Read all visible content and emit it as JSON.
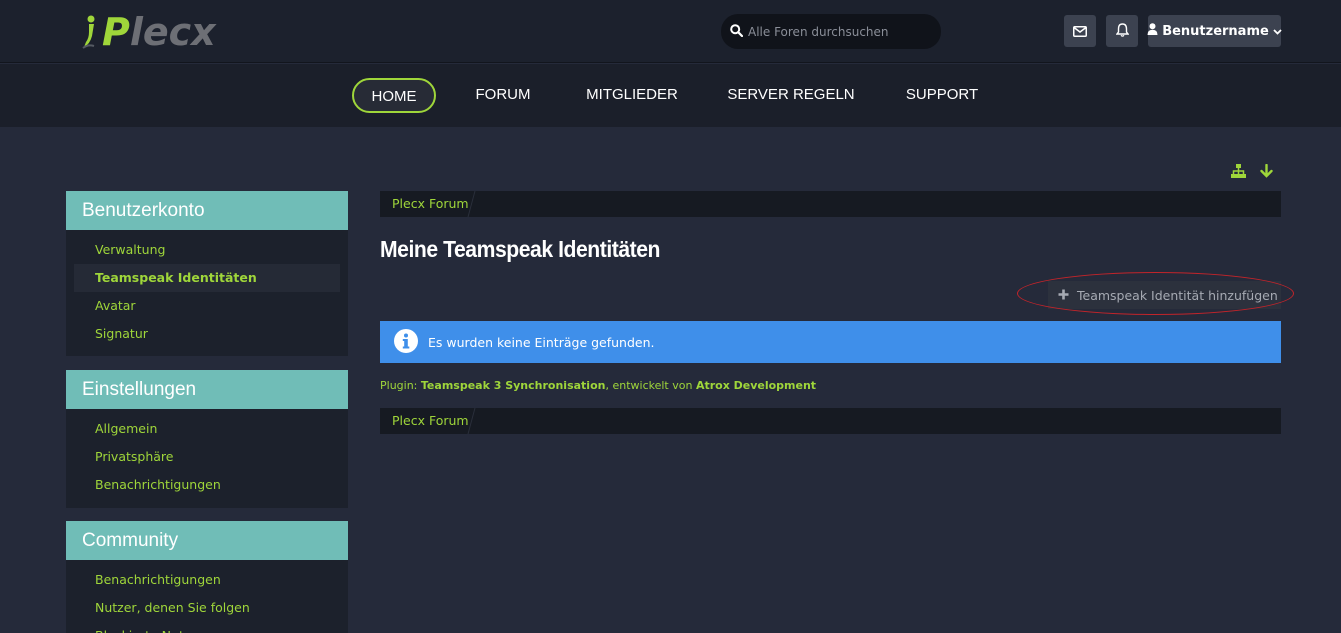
{
  "header": {
    "logo_text_first": "P",
    "logo_text_rest": "lecx",
    "search_placeholder": "Alle Foren durchsuchen",
    "username": "Benutzername"
  },
  "nav": {
    "items": [
      "HOME",
      "FORUM",
      "MITGLIEDER",
      "SERVER REGELN",
      "SUPPORT"
    ]
  },
  "sidebar": {
    "sections": [
      {
        "title": "Benutzerkonto",
        "items": [
          "Verwaltung",
          "Teamspeak Identitäten",
          "Avatar",
          "Signatur"
        ]
      },
      {
        "title": "Einstellungen",
        "items": [
          "Allgemein",
          "Privatsphäre",
          "Benachrichtigungen"
        ]
      },
      {
        "title": "Community",
        "items": [
          "Benachrichtigungen",
          "Nutzer, denen Sie folgen",
          "Blockierte Nutzer"
        ]
      }
    ]
  },
  "main": {
    "breadcrumb": "Plecx Forum",
    "title": "Meine Teamspeak Identitäten",
    "add_button": "Teamspeak Identität hinzufügen",
    "info_message": "Es wurden keine Einträge gefunden.",
    "plugin_prefix": "Plugin:",
    "plugin_name": "Teamspeak 3 Synchronisation",
    "plugin_middle": ", entwickelt von",
    "plugin_author": "Atrox Development"
  },
  "colors": {
    "accent": "#9fd63a",
    "sidebar_header": "#70bdb7",
    "info": "#3f8fea",
    "highlight": "#c2242a"
  }
}
